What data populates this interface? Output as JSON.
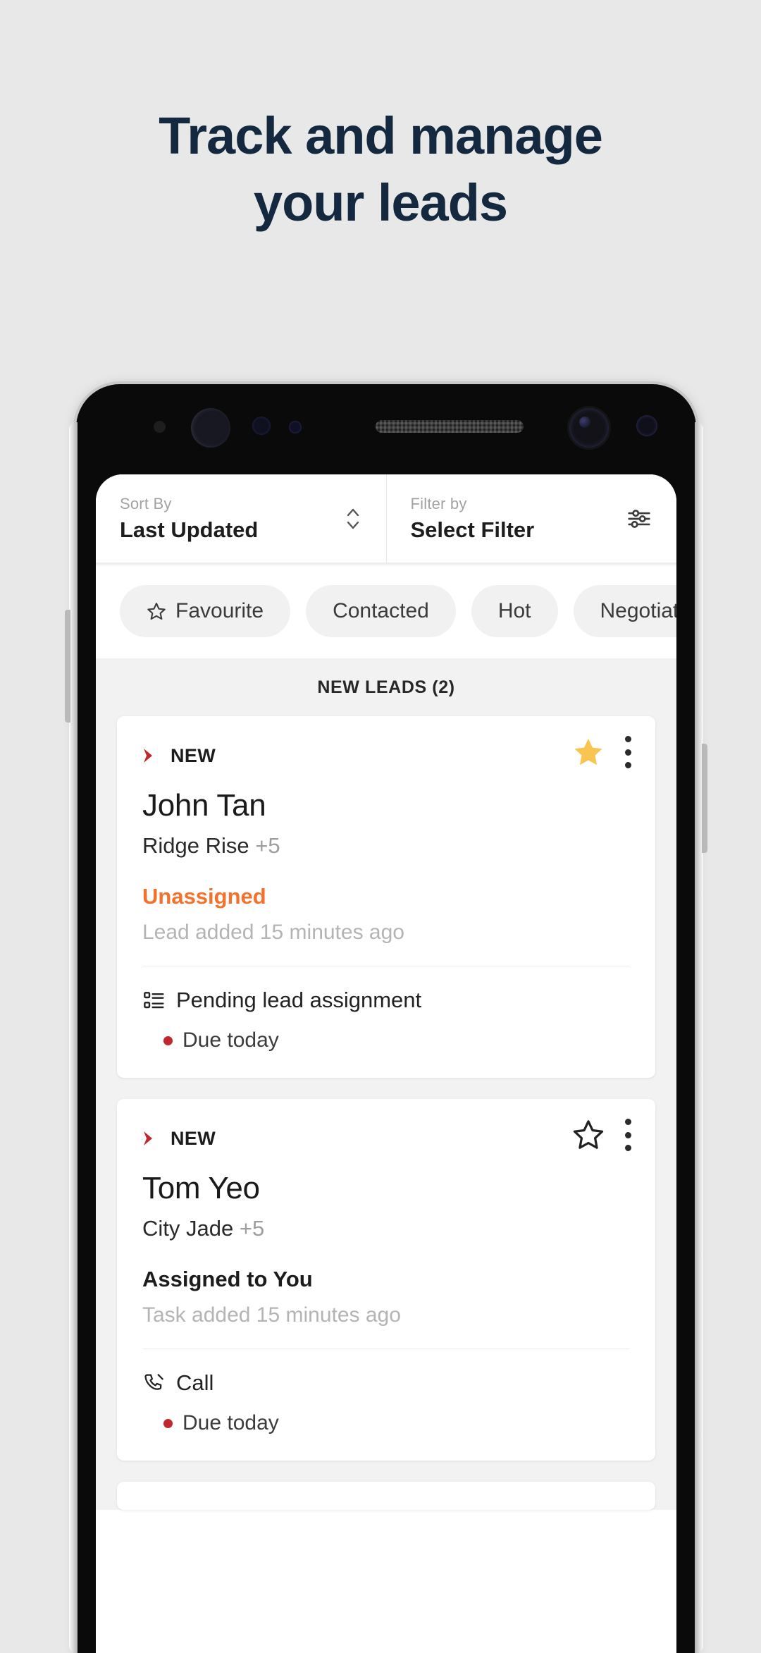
{
  "headline": {
    "line1": "Track and manage",
    "line2": "your leads"
  },
  "colors": {
    "background": "#e8e8e8",
    "headline": "#14293f",
    "accent_orange": "#f4712b",
    "accent_red": "#c1272d",
    "star_gold": "#f9c552",
    "chip_bg": "#f1f1f1"
  },
  "app": {
    "sort": {
      "label": "Sort By",
      "value": "Last Updated",
      "icon": "updown-chevron-icon"
    },
    "filter": {
      "label": "Filter by",
      "value": "Select Filter",
      "icon": "sliders-icon"
    },
    "chips": [
      {
        "label": "Favourite",
        "icon": "star-outline-icon"
      },
      {
        "label": "Contacted",
        "icon": ""
      },
      {
        "label": "Hot",
        "icon": ""
      },
      {
        "label": "Negotiating",
        "icon": ""
      }
    ],
    "section_header": "NEW LEADS (2)",
    "cards": [
      {
        "badge": "NEW",
        "name": "John Tan",
        "project": "Ridge Rise",
        "project_extra": "+5",
        "status": "Unassigned",
        "status_type": "unassigned",
        "added": "Lead added 15 minutes ago",
        "favourite": true,
        "task_icon": "list-icon",
        "task": "Pending lead assignment",
        "due": "Due today"
      },
      {
        "badge": "NEW",
        "name": "Tom Yeo",
        "project": "City Jade",
        "project_extra": "+5",
        "status": "Assigned to You",
        "status_type": "assigned",
        "added": "Task added 15 minutes ago",
        "favourite": false,
        "task_icon": "phone-icon",
        "task": "Call",
        "due": "Due today"
      }
    ]
  }
}
